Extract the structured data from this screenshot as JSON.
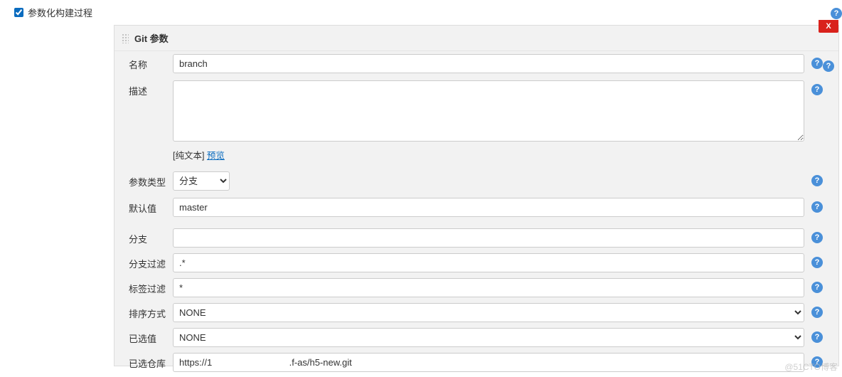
{
  "top": {
    "checkbox_label": "参数化构建过程",
    "checked": true
  },
  "section": {
    "title": "Git 参数",
    "close_label": "X"
  },
  "fields": {
    "name": {
      "label": "名称",
      "value": "branch"
    },
    "description": {
      "label": "描述",
      "value": ""
    },
    "hint_prefix": "[纯文本] ",
    "hint_link": "预览",
    "param_type": {
      "label": "参数类型",
      "selected": "分支",
      "options": [
        "分支"
      ]
    },
    "default_value": {
      "label": "默认值",
      "value": "master"
    },
    "branch": {
      "label": "分支",
      "value": ""
    },
    "branch_filter": {
      "label": "分支过滤",
      "value": ".*"
    },
    "tag_filter": {
      "label": "标签过滤",
      "value": "*"
    },
    "sort_mode": {
      "label": "排序方式",
      "selected": "NONE",
      "options": [
        "NONE"
      ]
    },
    "selected_value": {
      "label": "已选值",
      "selected": "NONE",
      "options": [
        "NONE"
      ]
    },
    "selected_repo": {
      "label": "已选仓库",
      "value": "https://1                              .f-as/h5-new.git"
    }
  },
  "watermark": "@51CTO博客"
}
